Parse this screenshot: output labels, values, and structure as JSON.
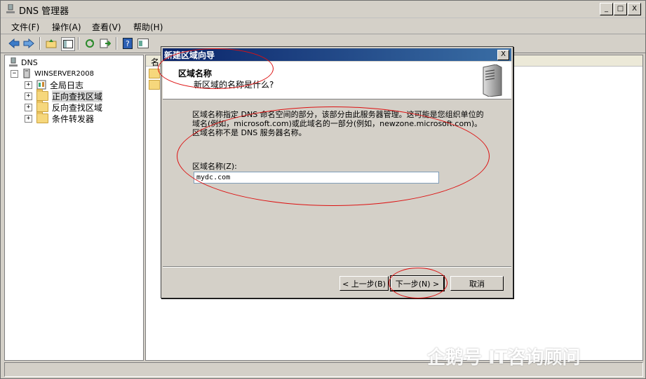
{
  "window": {
    "title": "DNS 管理器"
  },
  "window_buttons": {
    "minimize": "_",
    "maximize": "□",
    "close": "X"
  },
  "menu": [
    "文件(F)",
    "操作(A)",
    "查看(V)",
    "帮助(H)"
  ],
  "tree": {
    "root": "DNS",
    "server": "WINSERVER2008",
    "children": [
      "全局日志",
      "正向查找区域",
      "反向查找区域",
      "条件转发器"
    ],
    "selected": "正向查找区域"
  },
  "right_pane": {
    "column_header": "名"
  },
  "wizard": {
    "title": "新建区域向导",
    "header_title": "区域名称",
    "header_subtitle": "新区域的名称是什么?",
    "description": "区域名称指定 DNS 命名空间的部分，该部分由此服务器管理。这可能是您组织单位的域名(例如，microsoft.com)或此域名的一部分(例如，newzone.microsoft.com)。区域名称不是 DNS 服务器名称。",
    "zone_label": "区域名称(Z):",
    "zone_value": "mydc.com",
    "back_button": "< 上一步(B)",
    "next_button": "下一步(N) >",
    "cancel_button": "取消",
    "close": "X"
  },
  "watermark": "企鹅号 IT咨询顾问",
  "colors": {
    "title_bar": "#0a246a",
    "annotation": "#dd1111",
    "folder": "#f6d77c"
  }
}
